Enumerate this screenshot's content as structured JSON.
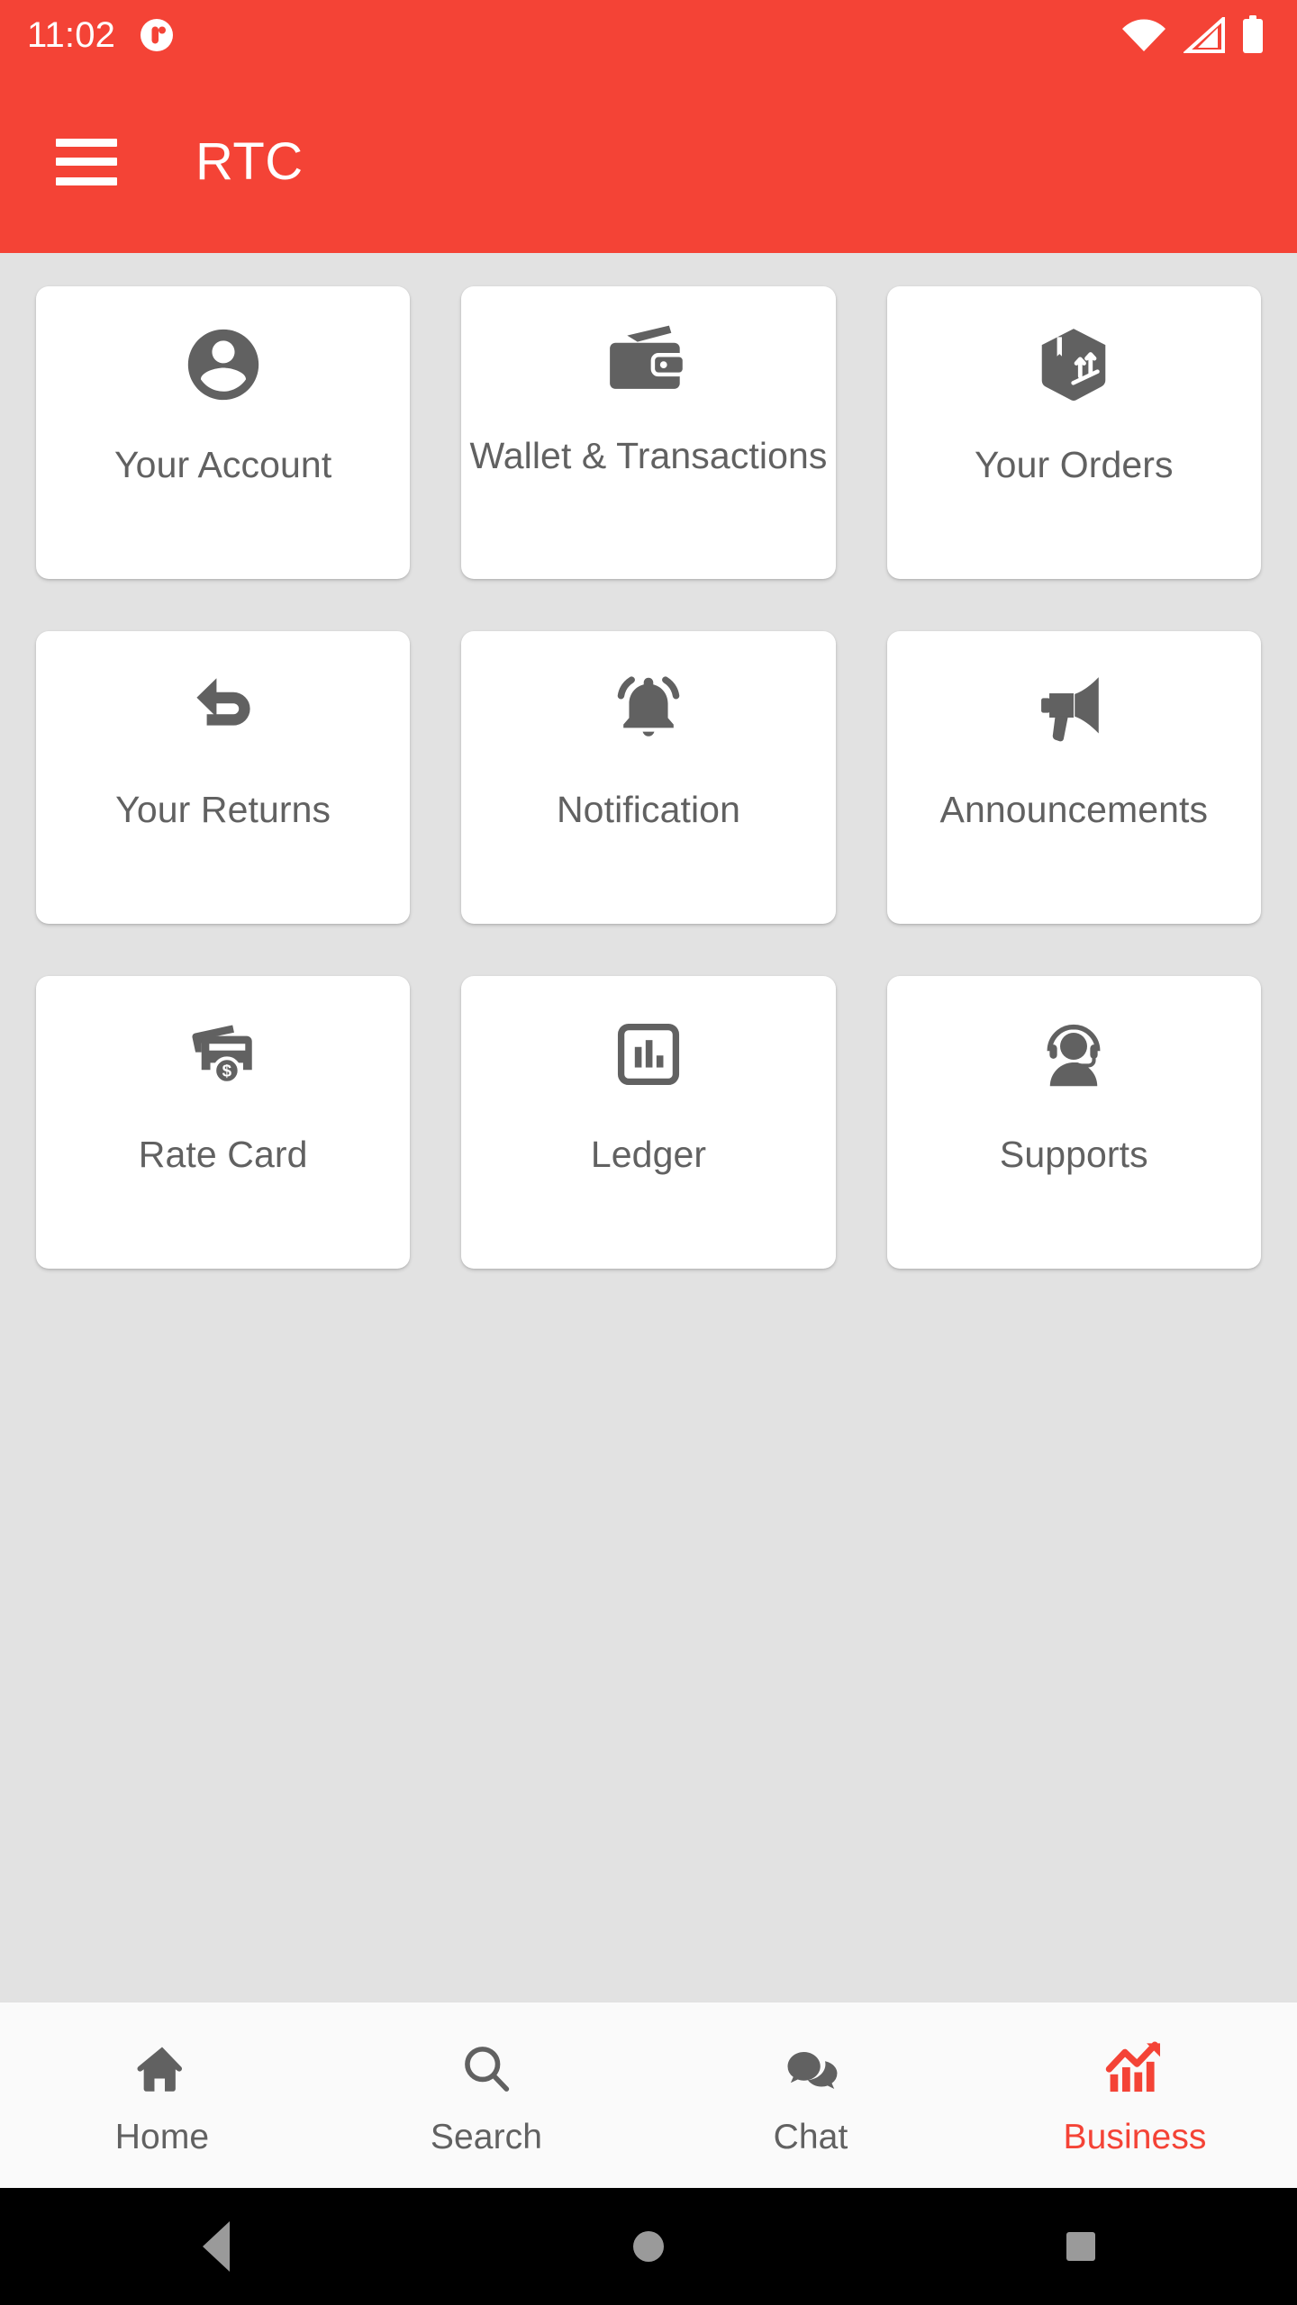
{
  "status_bar": {
    "time": "11:02",
    "app_badge_icon": "app-notification-badge-icon",
    "wifi_icon": "wifi-full-icon",
    "signal_icon": "cellular-signal-icon",
    "battery_icon": "battery-full-icon",
    "background_color": "#F44336"
  },
  "app_bar": {
    "menu_icon": "hamburger-menu-icon",
    "title": "RTC",
    "background_color": "#F44336",
    "text_color": "#FFFFFF"
  },
  "content": {
    "background_color": "#E2E2E2",
    "card_background_color": "#FFFFFF",
    "card_text_color": "#616161",
    "icon_color": "#616161",
    "cards": [
      {
        "label": "Your Account",
        "icon": "account-circle-icon"
      },
      {
        "label": "Wallet & Transactions",
        "icon": "wallet-icon"
      },
      {
        "label": "Your Orders",
        "icon": "package-box-icon"
      },
      {
        "label": "Your Returns",
        "icon": "return-arrow-icon"
      },
      {
        "label": "Notification",
        "icon": "bell-active-icon"
      },
      {
        "label": "Announcements",
        "icon": "megaphone-icon"
      },
      {
        "label": "Rate Card",
        "icon": "rate-card-dollar-icon"
      },
      {
        "label": "Ledger",
        "icon": "bar-chart-box-icon"
      },
      {
        "label": "Supports",
        "icon": "headset-support-icon"
      }
    ]
  },
  "bottom_nav": {
    "background_color": "#FAFAFA",
    "inactive_color": "#616161",
    "active_color": "#F44336",
    "items": [
      {
        "label": "Home",
        "icon": "home-icon",
        "active": false
      },
      {
        "label": "Search",
        "icon": "search-icon",
        "active": false
      },
      {
        "label": "Chat",
        "icon": "chat-bubbles-icon",
        "active": false
      },
      {
        "label": "Business",
        "icon": "trending-bar-chart-icon",
        "active": true
      }
    ]
  },
  "system_nav": {
    "background_color": "#000000",
    "icon_color": "#9A9A9A",
    "back_label": "back-button",
    "home_label": "home-button",
    "recents_label": "recents-button"
  }
}
